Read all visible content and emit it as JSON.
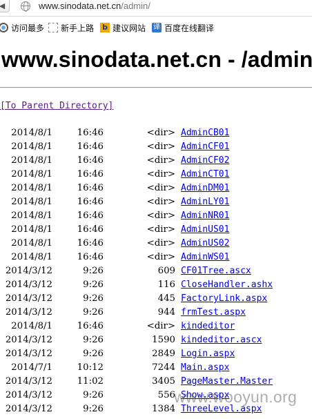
{
  "browser": {
    "url_host": "www.sinodata.net.cn",
    "url_path": "/admin/",
    "bookmarks": [
      {
        "label": "访问最多",
        "icon": "gear-icon"
      },
      {
        "label": "新手上路",
        "icon": "page-icon"
      },
      {
        "label": "建议网站",
        "icon": "bing-icon"
      },
      {
        "label": "百度在线翻译",
        "icon": "translate-icon"
      }
    ]
  },
  "page": {
    "title": "www.sinodata.net.cn - /admin/",
    "parent_link": "[To Parent Directory]",
    "entries": [
      {
        "date": "2014/8/1",
        "time": "16:46",
        "size": "<dir>",
        "name": "AdminCB01"
      },
      {
        "date": "2014/8/1",
        "time": "16:46",
        "size": "<dir>",
        "name": "AdminCF01"
      },
      {
        "date": "2014/8/1",
        "time": "16:46",
        "size": "<dir>",
        "name": "AdminCF02"
      },
      {
        "date": "2014/8/1",
        "time": "16:46",
        "size": "<dir>",
        "name": "AdminCT01"
      },
      {
        "date": "2014/8/1",
        "time": "16:46",
        "size": "<dir>",
        "name": "AdminDM01"
      },
      {
        "date": "2014/8/1",
        "time": "16:46",
        "size": "<dir>",
        "name": "AdminLY01"
      },
      {
        "date": "2014/8/1",
        "time": "16:46",
        "size": "<dir>",
        "name": "AdminNR01"
      },
      {
        "date": "2014/8/1",
        "time": "16:46",
        "size": "<dir>",
        "name": "AdminUS01"
      },
      {
        "date": "2014/8/1",
        "time": "16:46",
        "size": "<dir>",
        "name": "AdminUS02"
      },
      {
        "date": "2014/8/1",
        "time": "16:46",
        "size": "<dir>",
        "name": "AdminWS01"
      },
      {
        "date": "2014/3/12",
        "time": "9:26",
        "size": "609",
        "name": "CF01Tree.ascx"
      },
      {
        "date": "2014/3/12",
        "time": "9:26",
        "size": "116",
        "name": "CloseHandler.ashx"
      },
      {
        "date": "2014/3/12",
        "time": "9:26",
        "size": "445",
        "name": "FactoryLink.aspx"
      },
      {
        "date": "2014/3/12",
        "time": "9:26",
        "size": "944",
        "name": "frmTest.aspx"
      },
      {
        "date": "2014/8/1",
        "time": "16:46",
        "size": "<dir>",
        "name": "kindeditor"
      },
      {
        "date": "2014/3/12",
        "time": "9:26",
        "size": "1590",
        "name": "kindeditor.ascx"
      },
      {
        "date": "2014/3/12",
        "time": "9:26",
        "size": "2849",
        "name": "Login.aspx"
      },
      {
        "date": "2014/7/1",
        "time": "10:12",
        "size": "7244",
        "name": "Main.aspx"
      },
      {
        "date": "2014/3/12",
        "time": "11:02",
        "size": "3405",
        "name": "PageMaster.Master"
      },
      {
        "date": "2014/3/12",
        "time": "9:26",
        "size": "556",
        "name": "Show.aspx"
      },
      {
        "date": "2014/3/12",
        "time": "9:26",
        "size": "1384",
        "name": "ThreeLevel.aspx"
      }
    ]
  },
  "watermark": "www.wooyun.org"
}
